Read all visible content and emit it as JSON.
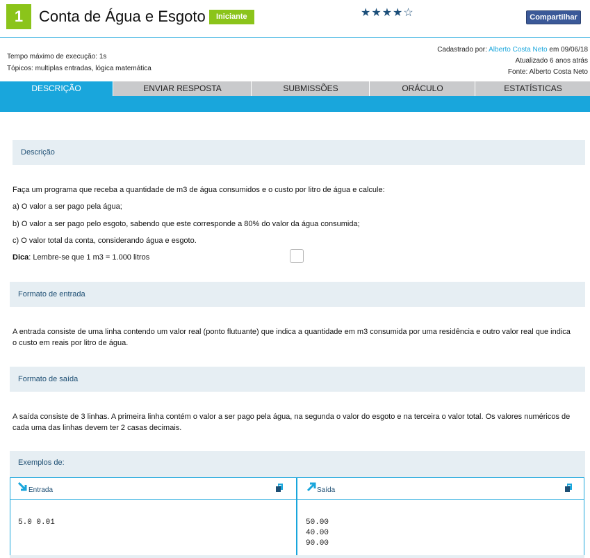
{
  "problem": {
    "number": "1",
    "title": "Conta de Água e Esgoto",
    "level": "Iniciante",
    "rating_stars": "★★★★☆",
    "share_label": "Compartilhar"
  },
  "meta": {
    "time_limit": "Tempo máximo de execução: 1s",
    "topics": "Tópicos: multiplas entradas, lógica matemática",
    "registered_prefix": "Cadastrado por: ",
    "author": "Alberto Costa Neto",
    "registered_suffix": " em 09/06/18",
    "updated": "Atualizado 6 anos atrás",
    "source": "Fonte: Alberto Costa Neto"
  },
  "tabs": [
    {
      "label": "DESCRIÇÃO",
      "active": true
    },
    {
      "label": "ENVIAR RESPOSTA"
    },
    {
      "label": "SUBMISSÕES"
    },
    {
      "label": "ORÁCULO"
    },
    {
      "label": "ESTATÍSTICAS"
    }
  ],
  "description": {
    "heading": "Descrição",
    "intro": "Faça um programa que receba a quantidade de m3 de água consumidos e o custo por litro de água e calcule:",
    "item_a": "a) O valor a ser pago pela água;",
    "item_b": "b) O valor a ser pago pelo esgoto, sabendo que este corresponde a 80% do valor da água consumida;",
    "item_c": "c) O valor total da conta, considerando água e esgoto.",
    "tip_label": "Dica",
    "tip_text": ": Lembre-se que 1 m3 = 1.000 litros"
  },
  "input_format": {
    "heading": "Formato de entrada",
    "text": "A entrada consiste de uma linha contendo um valor real (ponto flutuante) que indica a quantidade em m3 consumida por uma residência e outro valor real que indica o custo em reais por litro de água."
  },
  "output_format": {
    "heading": "Formato de saída",
    "text": "A saída consiste de 3 linhas. A primeira linha contém o valor a ser pago pela água, na segunda o valor do esgoto e na terceira o valor total. Os valores numéricos de cada uma das linhas devem ter 2 casas decimais."
  },
  "examples": {
    "heading": "Exemplos de:",
    "input_label": "Entrada",
    "output_label": "Saída",
    "input_value": "5.0 0.01",
    "output_value": "50.00\n40.00\n90.00"
  },
  "colors": {
    "accent": "#19a6dc",
    "level_green": "#8bc41a",
    "section_bg": "#e6eef3",
    "section_text": "#1d4e73",
    "facebook_blue": "#3b5998"
  }
}
